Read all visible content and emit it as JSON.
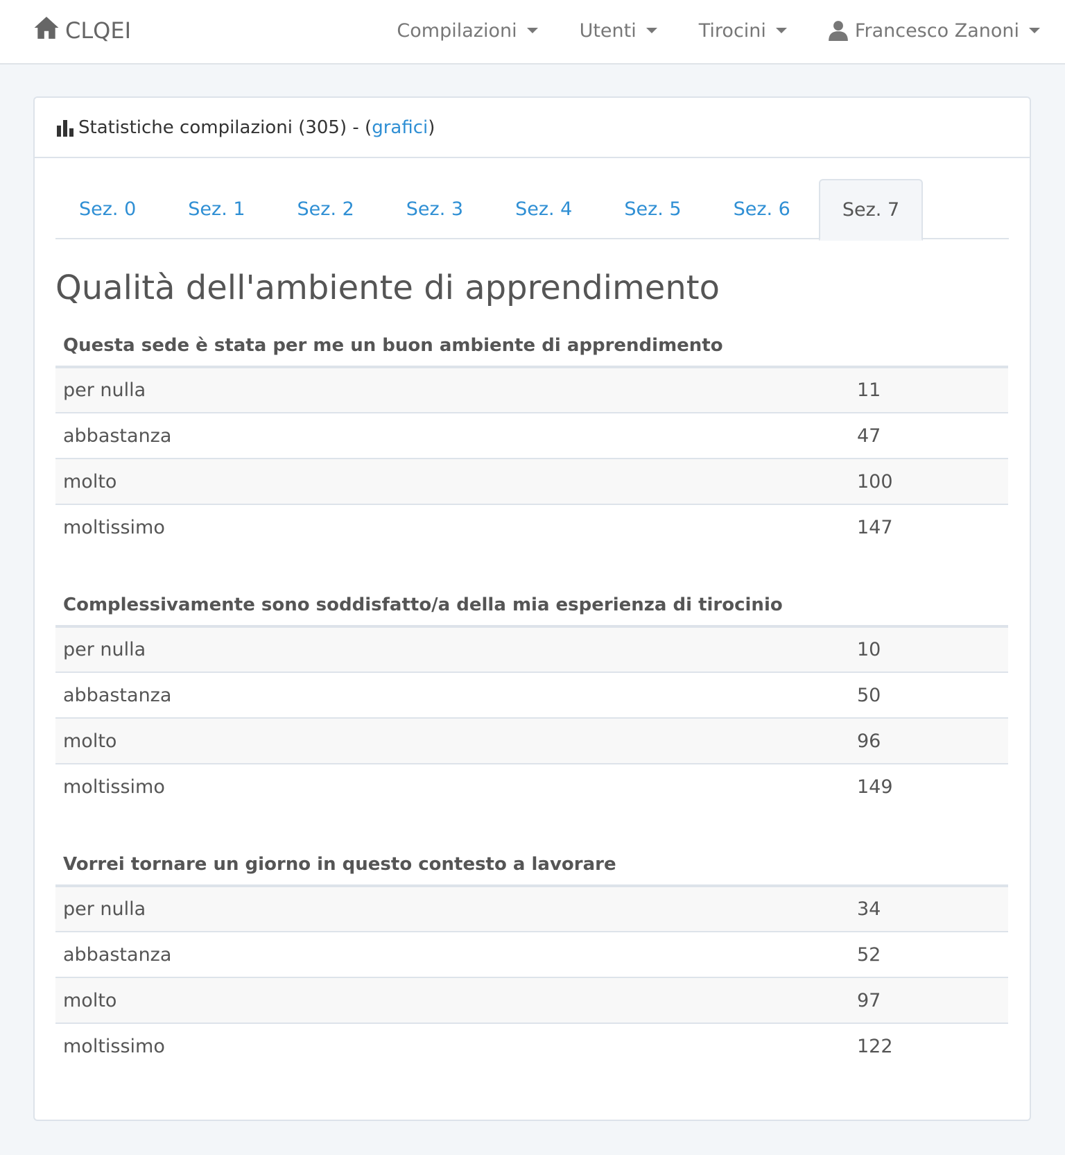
{
  "navbar": {
    "brand": "CLQEI",
    "menu": [
      {
        "label": "Compilazioni",
        "name": "nav-compilazioni"
      },
      {
        "label": "Utenti",
        "name": "nav-utenti"
      },
      {
        "label": "Tirocini",
        "name": "nav-tirocini"
      }
    ],
    "user": "Francesco Zanoni"
  },
  "panel": {
    "title": "Statistiche compilazioni (305) - (",
    "link": "grafici",
    "title_end": ")"
  },
  "tabs": [
    "Sez. 0",
    "Sez. 1",
    "Sez. 2",
    "Sez. 3",
    "Sez. 4",
    "Sez. 5",
    "Sez. 6",
    "Sez. 7"
  ],
  "active_tab": 7,
  "section_title": "Qualità dell'ambiente di apprendimento",
  "questions": [
    {
      "title": "Questa sede è stata per me un buon ambiente di apprendimento",
      "rows": [
        {
          "label": "per nulla",
          "value": "11"
        },
        {
          "label": "abbastanza",
          "value": "47"
        },
        {
          "label": "molto",
          "value": "100"
        },
        {
          "label": "moltissimo",
          "value": "147"
        }
      ]
    },
    {
      "title": "Complessivamente sono soddisfatto/a della mia esperienza di tirocinio",
      "rows": [
        {
          "label": "per nulla",
          "value": "10"
        },
        {
          "label": "abbastanza",
          "value": "50"
        },
        {
          "label": "molto",
          "value": "96"
        },
        {
          "label": "moltissimo",
          "value": "149"
        }
      ]
    },
    {
      "title": "Vorrei tornare un giorno in questo contesto a lavorare",
      "rows": [
        {
          "label": "per nulla",
          "value": "34"
        },
        {
          "label": "abbastanza",
          "value": "52"
        },
        {
          "label": "molto",
          "value": "97"
        },
        {
          "label": "moltissimo",
          "value": "122"
        }
      ]
    }
  ],
  "colors": {
    "link": "#2f8fd4",
    "text": "#555555",
    "background": "#f3f6f9"
  }
}
